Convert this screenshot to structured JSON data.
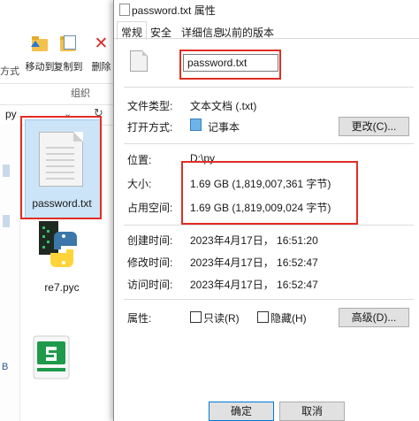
{
  "explorer": {
    "ribbon": {
      "left_partial": "方式",
      "move_to": "移动到",
      "copy_to": "复制到",
      "delete": "删除",
      "group_label": "组织"
    },
    "address": "py",
    "files": [
      {
        "name": "password.txt",
        "icon": "text-file-icon"
      },
      {
        "name": "re7.pyc",
        "icon": "python-file-icon"
      },
      {
        "name": "",
        "icon": "green-app-icon"
      }
    ],
    "nav_partial": "B"
  },
  "dialog": {
    "title": "password.txt 属性",
    "tabs": [
      "常规",
      "安全",
      "详细信息",
      "以前的版本"
    ],
    "active_tab": "常规",
    "file_name": "password.txt",
    "rows": {
      "type_label": "文件类型:",
      "type_value": "文本文档 (.txt)",
      "open_label": "打开方式:",
      "open_value": "记事本",
      "change_button": "更改(C)...",
      "location_label": "位置:",
      "location_value": "D:\\py",
      "size_label": "大小:",
      "size_value": "1.69 GB (1,819,007,361 字节)",
      "disk_label": "占用空间:",
      "disk_value": "1.69 GB (1,819,009,024 字节)",
      "created_label": "创建时间:",
      "created_value": "2023年4月17日， 16:51:20",
      "modified_label": "修改时间:",
      "modified_value": "2023年4月17日， 16:52:47",
      "accessed_label": "访问时间:",
      "accessed_value": "2023年4月17日， 16:52:47",
      "attr_label": "属性:",
      "readonly_label": "只读(R)",
      "hidden_label": "隐藏(H)",
      "advanced_button": "高级(D)..."
    },
    "ok_button": "确定",
    "cancel_button": "取消"
  },
  "colors": {
    "highlight_red": "#e02e24",
    "selection_blue": "#cce4f7",
    "accent_blue": "#0078d7"
  }
}
